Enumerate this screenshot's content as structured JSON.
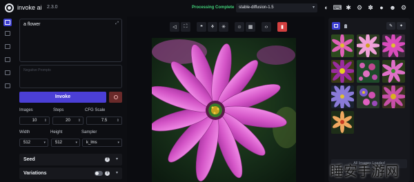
{
  "header": {
    "app_name": "invoke ai",
    "version": "2.3.0",
    "status": "Processing Complete",
    "model": "stable-diffusion-1.5",
    "icons": [
      "theme-icon",
      "keyboard-icon",
      "palette-icon",
      "settings-icon",
      "bug-icon",
      "github-icon",
      "discord-icon",
      "gear-icon"
    ]
  },
  "rail": {
    "items": [
      "text-to-image-icon",
      "image-to-image-icon",
      "unified-canvas-icon",
      "nodes-icon",
      "postprocessing-icon",
      "training-icon"
    ]
  },
  "prompt": {
    "value": "a flower",
    "negative_placeholder": "Negative Prompts"
  },
  "buttons": {
    "invoke": "Invoke"
  },
  "params": {
    "images_label": "Images",
    "images_value": "10",
    "steps_label": "Steps",
    "steps_value": "20",
    "cfg_label": "CFG Scale",
    "cfg_value": "7.5",
    "width_label": "Width",
    "width_value": "512",
    "height_label": "Height",
    "height_value": "512",
    "sampler_label": "Sampler",
    "sampler_value": "k_lms"
  },
  "accordions": {
    "seed": "Seed",
    "variations": "Variations"
  },
  "toolbar": {
    "buttons": [
      "share-icon",
      "expand-icon",
      "quote-icon",
      "sprout-icon",
      "asterisk-icon",
      "face-icon",
      "grid-icon",
      "code-icon",
      "trash-icon"
    ]
  },
  "gallery": {
    "loaded_text": "All Images Loaded"
  },
  "watermark": "睡安手游网",
  "colors": {
    "accent": "#4b3fd6",
    "status": "#43d17a",
    "danger": "#d44040"
  }
}
